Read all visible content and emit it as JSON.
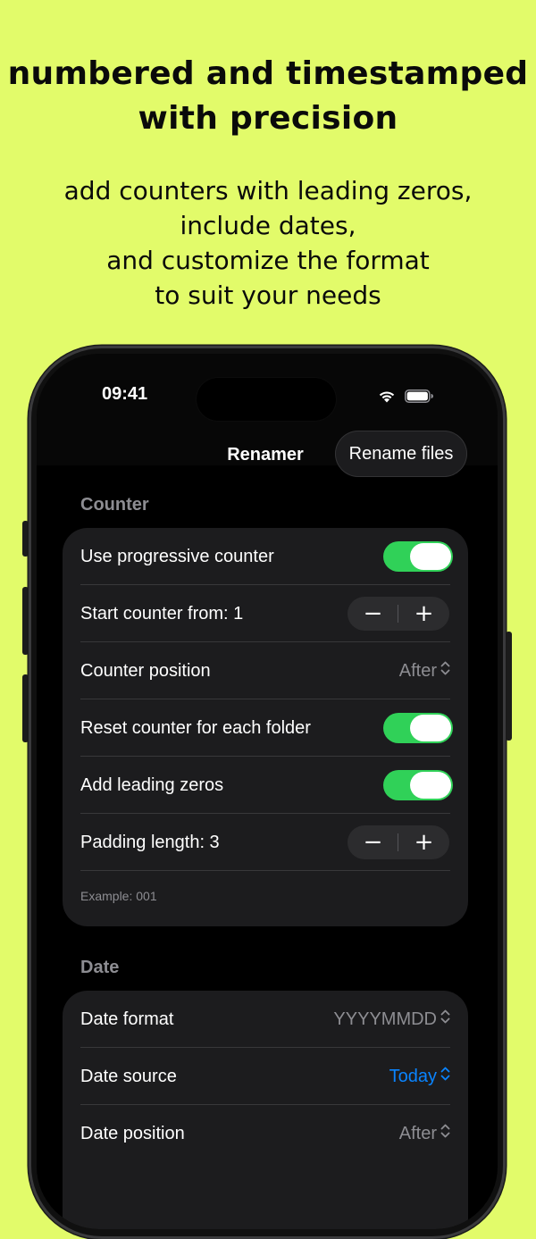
{
  "headline": {
    "line1": "numbered and timestamped",
    "line2": "with precision"
  },
  "subline": {
    "line1": "add counters with leading zeros,",
    "line2": "include dates,",
    "line3": "and customize the format",
    "line4": "to suit your needs"
  },
  "status": {
    "time": "09:41"
  },
  "nav": {
    "title": "Renamer",
    "rename_label": "Rename files"
  },
  "counter": {
    "header": "Counter",
    "use_progressive": "Use progressive counter",
    "start_from": "Start counter from: 1",
    "position_label": "Counter position",
    "position_value": "After",
    "reset_each_folder": "Reset counter for each folder",
    "leading_zeros": "Add leading zeros",
    "padding_length": "Padding length: 3",
    "example": "Example: 001"
  },
  "date": {
    "header": "Date",
    "format_label": "Date format",
    "format_value": "YYYYMMDD",
    "source_label": "Date source",
    "source_value": "Today",
    "position_label": "Date position",
    "position_value": "After"
  },
  "stepper": {
    "minus": "−",
    "plus": "+"
  },
  "colors": {
    "background": "#e2fb6a",
    "toggle_on": "#30d158",
    "accent_blue": "#0a84ff"
  }
}
